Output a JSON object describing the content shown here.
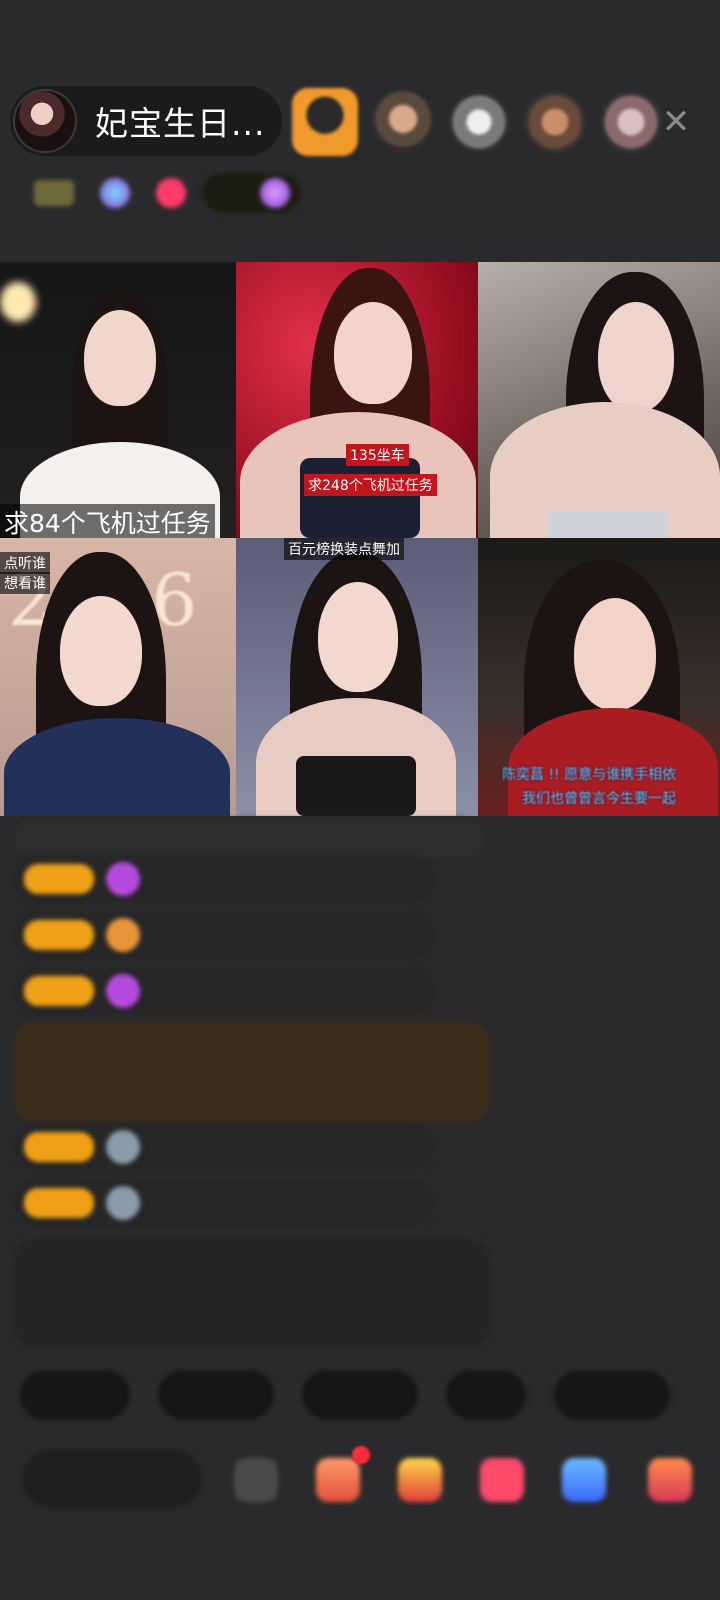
{
  "host": {
    "name": "妃宝生日..."
  },
  "close_label": "✕",
  "viewers": [
    {
      "name": "viewer-1"
    },
    {
      "name": "viewer-2"
    },
    {
      "name": "viewer-3"
    },
    {
      "name": "viewer-4"
    },
    {
      "name": "viewer-5"
    }
  ],
  "rank_bar": {
    "item_1": "",
    "item_2": "",
    "tags": [
      "",
      "",
      ""
    ]
  },
  "streams": [
    {
      "caption": "求84个飞机过任务"
    },
    {
      "caption_top": "135坐车",
      "caption_bottom": "求248个飞机过任务"
    },
    {
      "caption": ""
    },
    {
      "caption_1": "点听谁",
      "caption_2": "想看谁",
      "number": "2026"
    },
    {
      "caption": "百元榜换装点舞加"
    },
    {
      "caption_1": "陈奕菖 !! 愿意与谁携手相依",
      "caption_2": "我们也曾曾言今生要一起"
    }
  ],
  "chat": [
    {
      "level": "",
      "user": "",
      "text": ""
    },
    {
      "level": "",
      "user": "",
      "text": ""
    },
    {
      "level": "",
      "user": "",
      "text": ""
    },
    {
      "level": "",
      "user": "",
      "text": ""
    },
    {
      "level": "",
      "user": "",
      "text": ""
    },
    {
      "level": "",
      "user": "",
      "text": ""
    }
  ],
  "quick_actions": [
    "",
    "",
    "",
    "",
    ""
  ],
  "input_placeholder": "",
  "colors": {
    "accent": "#f0a016",
    "background": "#2a2a2c",
    "live_red": "#c2161d"
  }
}
